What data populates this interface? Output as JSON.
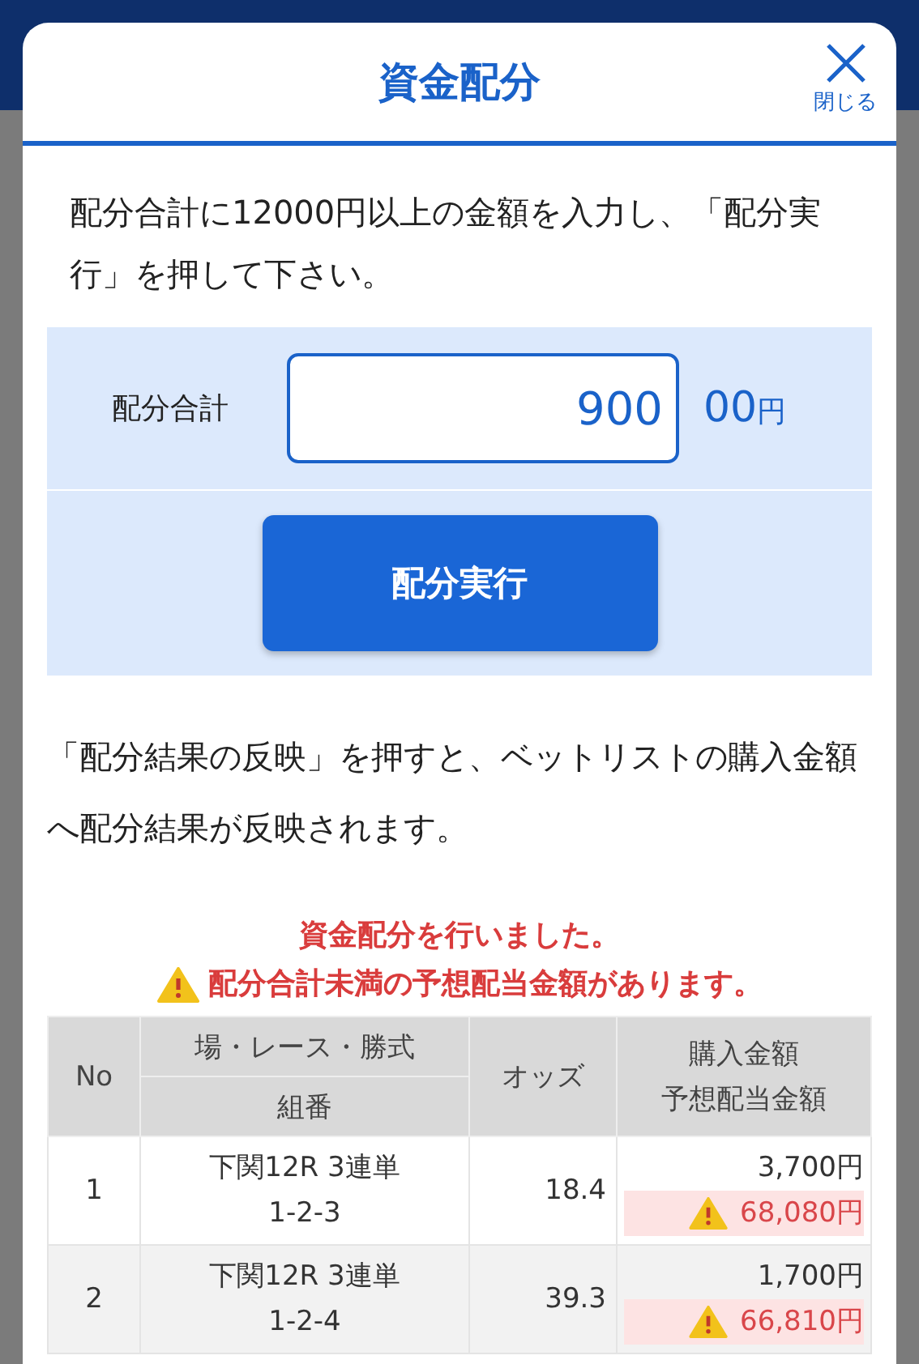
{
  "modal": {
    "title": "資金配分",
    "close_label": "閉じる"
  },
  "intro": "配分合計に12000円以上の金額を入力し、「配分実行」を押して下さい。",
  "total": {
    "label": "配分合計",
    "value": "900",
    "suffix": "00",
    "unit": "円"
  },
  "execute_button": "配分実行",
  "note": "「配分結果の反映」を押すと、ベットリストの購入金額へ配分結果が反映されます。",
  "messages": [
    {
      "kind": "info",
      "text": "資金配分を行いました。"
    },
    {
      "kind": "warning",
      "text": "配分合計未満の予想配当金額があります。"
    }
  ],
  "table": {
    "columns": {
      "no": "No",
      "race": "場・レース・勝式",
      "combo": "組番",
      "odds": "オッズ",
      "amount": "購入金額",
      "payout": "予想配当金額"
    },
    "rows": [
      {
        "no": "1",
        "race": "下関12R 3連単",
        "combo": "1-2-3",
        "odds": "18.4",
        "amount": "3,700円",
        "payout": "68,080円",
        "warning": true
      },
      {
        "no": "2",
        "race": "下関12R 3連単",
        "combo": "1-2-4",
        "odds": "39.3",
        "amount": "1,700円",
        "payout": "66,810円",
        "warning": true
      }
    ]
  }
}
